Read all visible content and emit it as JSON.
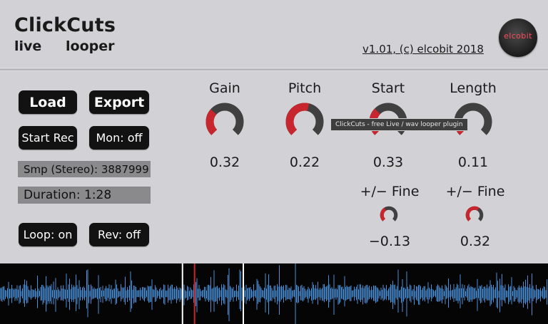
{
  "brand": {
    "title": "ClickCuts",
    "sub1": "live",
    "sub2": "looper"
  },
  "version": "v1.01, (c) elcobit 2018",
  "logo": "elcobit",
  "buttons": {
    "load": "Load",
    "export": "Export",
    "start_rec": "Start Rec",
    "mon": "Mon: off",
    "loop": "Loop: on",
    "rev": "Rev: off"
  },
  "info": {
    "samples": "Smp (Stereo): 3887999",
    "duration": "Duration: 1:28"
  },
  "knobs": [
    {
      "label": "Gain",
      "value": "0.32",
      "level": 0.32
    },
    {
      "label": "Pitch",
      "value": "0.22",
      "level": 0.55
    },
    {
      "label": "Start",
      "value": "0.33",
      "level": 0.33
    },
    {
      "label": "Length",
      "value": "0.11",
      "level": 0.11
    }
  ],
  "fine": [
    {
      "label": "+/− Fine",
      "value": "−0.13",
      "level": 0.38
    },
    {
      "label": "+/− Fine",
      "value": "0.32",
      "level": 0.62
    }
  ],
  "tooltip": "ClickCuts - free Live / wav looper plugin",
  "waveform": {
    "playhead_fraction": 0.355,
    "selection_start": 0.333,
    "selection_end": 0.444
  },
  "colors": {
    "accent": "#c8262e",
    "track": "#404040",
    "wave": "#4a90d9",
    "playhead": "#c8262e"
  }
}
